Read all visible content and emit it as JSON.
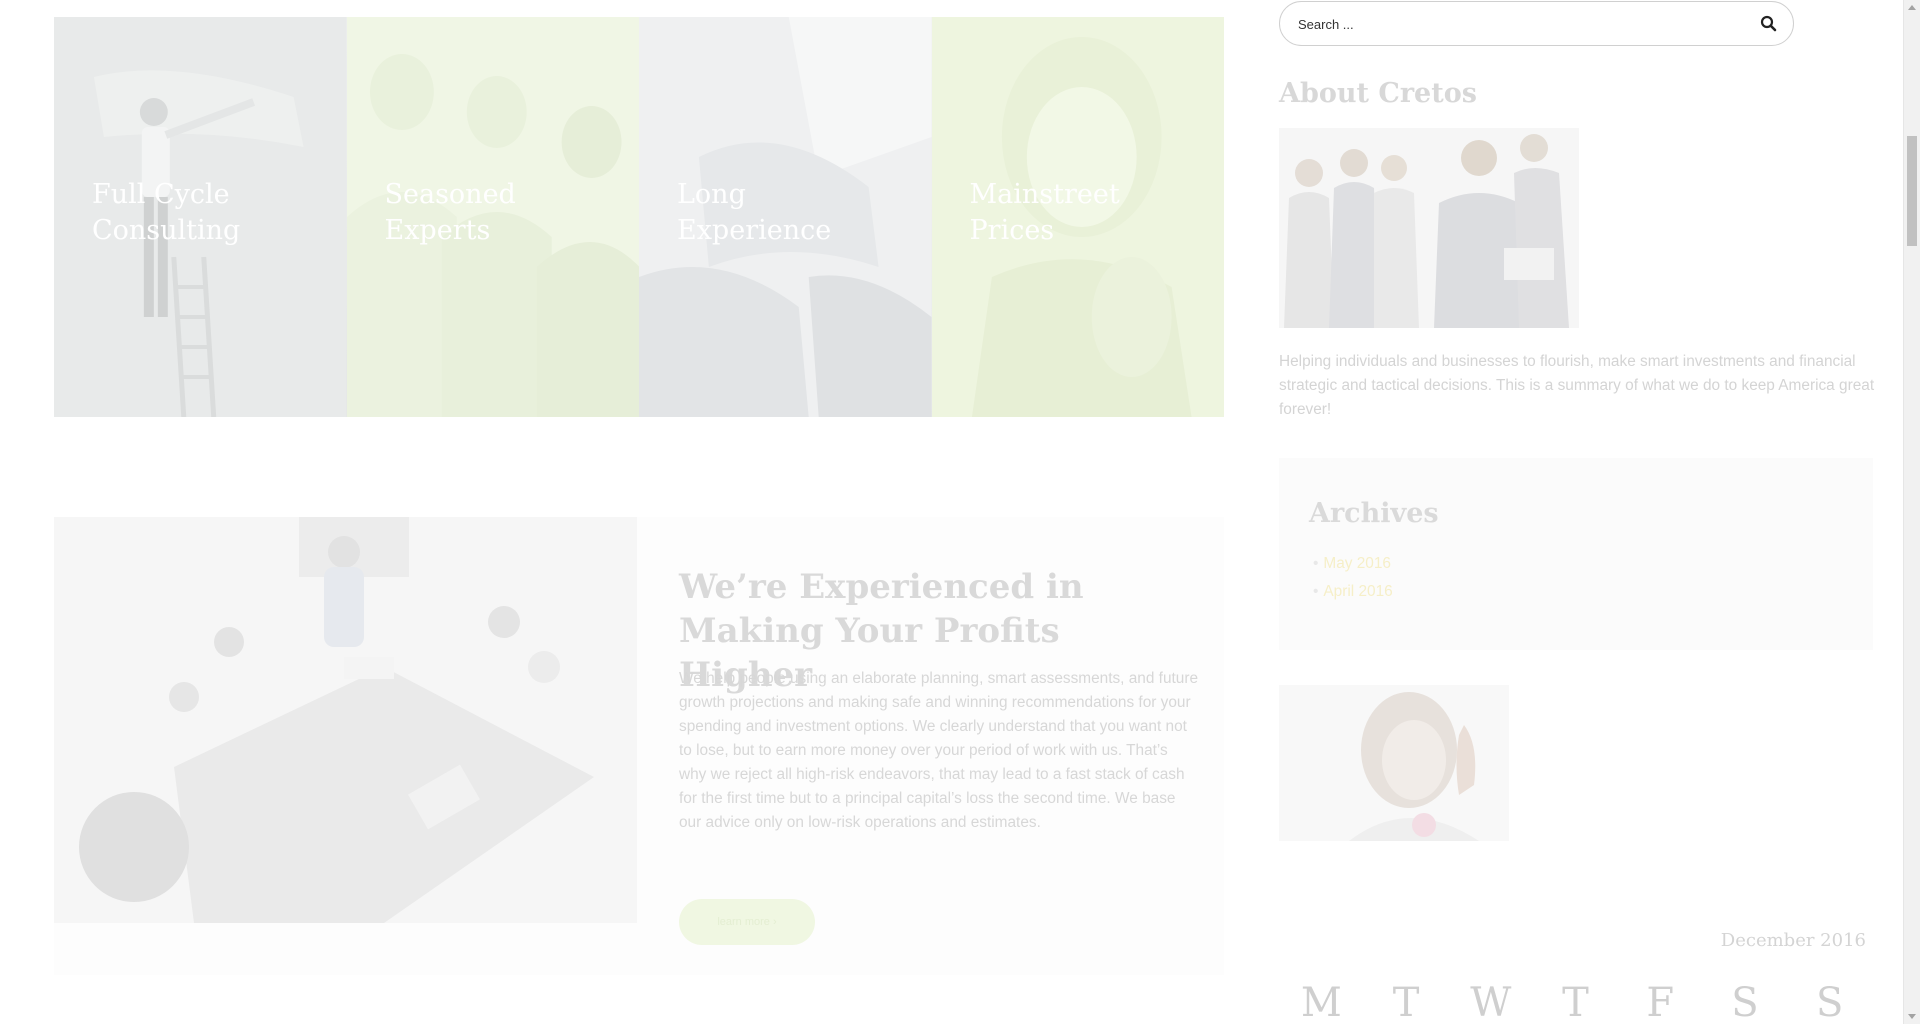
{
  "features": [
    {
      "title": "Full Cycle\nConsulting"
    },
    {
      "title": "Seasoned\nExperts"
    },
    {
      "title": "Long\nExperience"
    },
    {
      "title": "Mainstreet\nPrices"
    }
  ],
  "experience": {
    "heading": "We’re Experienced in Making Your Profits Higher",
    "text": "We help people using an elaborate planning, smart assessments, and future growth projections and making safe and winning recommendations for your spending and investment options. We clearly understand that you want not to lose, but to earn more money over your period of work with us. That’s why we reject all high-risk endeavors, that may lead to a fast stack of cash for the first time but to a principal capital’s loss the second time. We base our advice only on low-risk operations and estimates.",
    "button_label": "learn more ›"
  },
  "sidebar": {
    "search": {
      "placeholder": "Search ..."
    },
    "about": {
      "title": "About Cretos",
      "text": "Helping individuals and businesses to flourish, make smart investments and financial strategic and tactical decisions. This is a summary of what we do to keep America great forever!"
    },
    "archives": {
      "title": "Archives",
      "items": [
        {
          "label": "May 2016"
        },
        {
          "label": "April 2016"
        }
      ]
    },
    "calendar": {
      "caption": "December 2016",
      "days": [
        "M",
        "T",
        "W",
        "T",
        "F",
        "S",
        "S"
      ]
    }
  },
  "icons": {
    "search": "magnifier-icon"
  },
  "colors": {
    "accent_green": "#eef6df",
    "button_green": "#f0f7e2",
    "archive_link": "#f6efc8"
  }
}
